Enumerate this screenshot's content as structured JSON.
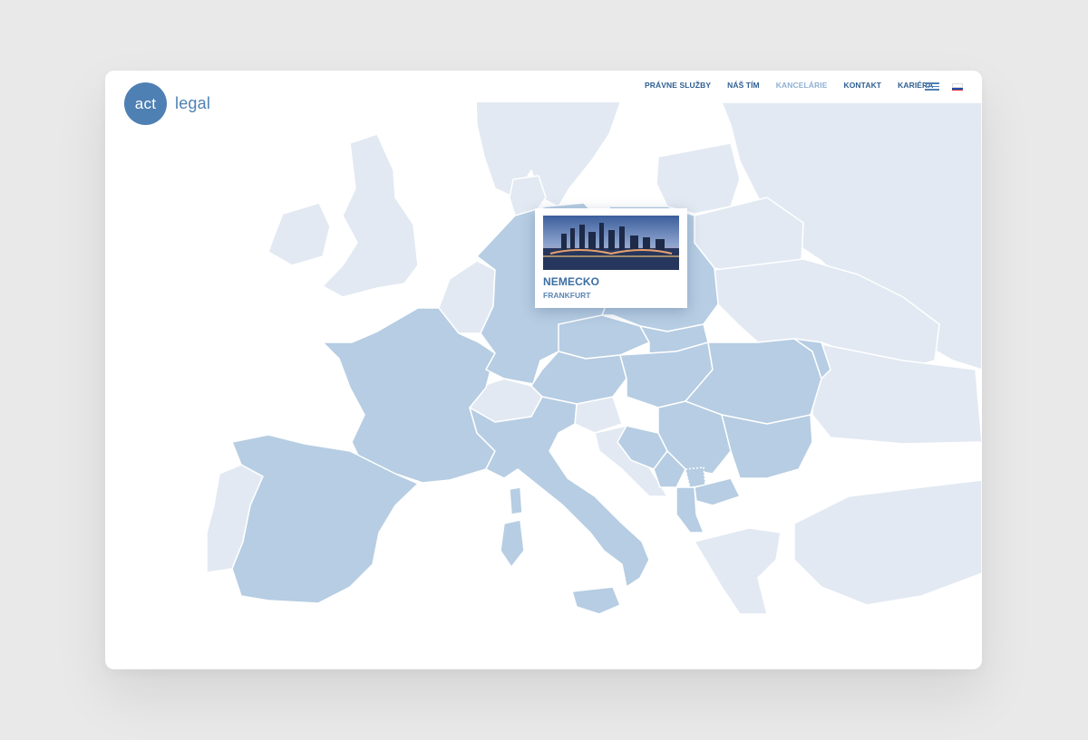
{
  "brand": {
    "logo_mark": "act",
    "logo_word": "legal"
  },
  "nav": {
    "items": [
      {
        "label": "PRÁVNE SLUŽBY"
      },
      {
        "label": "NÁŠ TÍM"
      },
      {
        "label": "KANCELÁRIE"
      },
      {
        "label": "KONTAKT"
      },
      {
        "label": "KARIÉRA"
      }
    ],
    "active_index": 2
  },
  "header": {
    "menu_icon": "hamburger-icon",
    "language_icon": "slovak-flag-icon"
  },
  "popup": {
    "country": "NEMECKO",
    "city": "FRANKFURT",
    "photo_icon": "frankfurt-skyline-photo"
  },
  "colors": {
    "brand_blue": "#4f80b3",
    "nav_text": "#2f5f93",
    "nav_active": "#8fb0d2",
    "office_country": "#b6cde3",
    "other_country": "#e2e9f2"
  }
}
